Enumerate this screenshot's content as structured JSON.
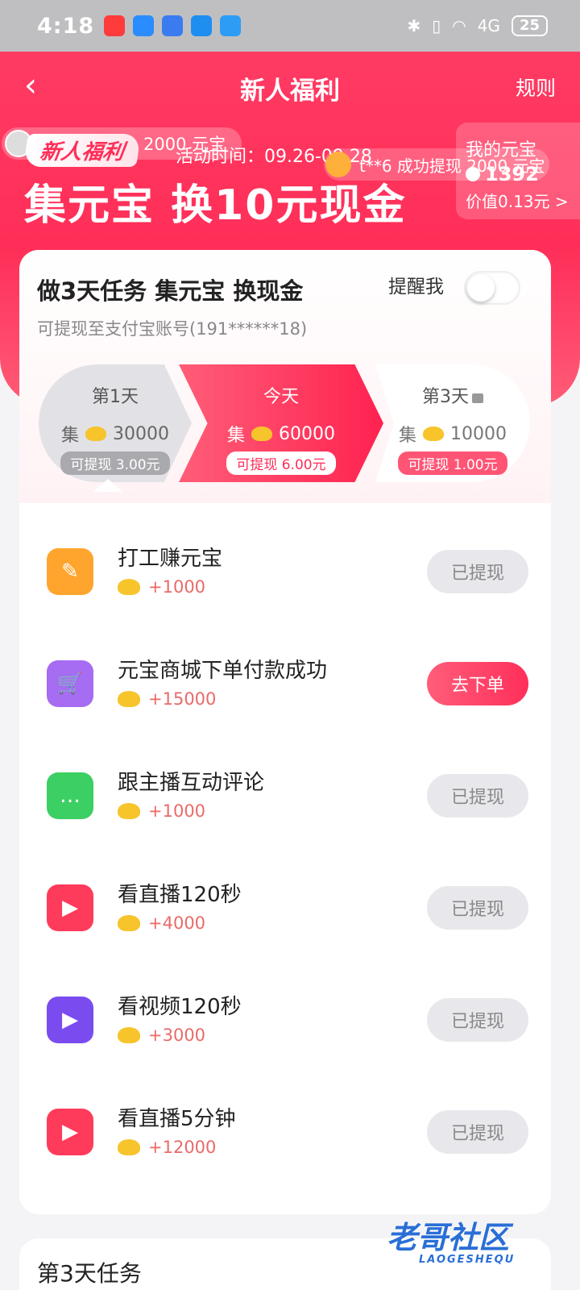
{
  "status": {
    "time": "4:18",
    "battery": "25",
    "network": "4G"
  },
  "nav": {
    "title": "新人福利",
    "rules_label": "规则"
  },
  "hero": {
    "ticker_left": "2000 元宝",
    "badge": "新人福利",
    "activity_time": "活动时间：09.26-09.28",
    "ticker_right": "t**6 成功提现 2000 元宝",
    "headline": "集元宝 换10元现金",
    "my_coins_label": "我的元宝",
    "my_coins_value": "1392",
    "my_coins_worth": "价值0.13元 >"
  },
  "card": {
    "title": "做3天任务 集元宝 换现金",
    "remind_label": "提醒我",
    "remind_on": false,
    "subtitle": "可提现至支付宝账号(191******18)",
    "days": [
      {
        "label": "第1天",
        "collect": "集",
        "amount": "30000",
        "withdraw": "可提现 3.00元"
      },
      {
        "label": "今天",
        "collect": "集",
        "amount": "60000",
        "withdraw": "可提现 6.00元"
      },
      {
        "label": "第3天",
        "collect": "集",
        "amount": "10000",
        "withdraw": "可提现 1.00元"
      }
    ]
  },
  "tasks": [
    {
      "name": "打工赚元宝",
      "reward": "+1000",
      "button": "已提现",
      "icon": "brush-icon",
      "icon_color": "#ffa52e"
    },
    {
      "name": "元宝商城下单付款成功",
      "reward": "+15000",
      "button": "去下单",
      "icon": "shopping-cart-icon",
      "icon_color": "#a66cf2"
    },
    {
      "name": "跟主播互动评论",
      "reward": "+1000",
      "button": "已提现",
      "icon": "chat-bubble-icon",
      "icon_color": "#3ccf63"
    },
    {
      "name": "看直播120秒",
      "reward": "+4000",
      "button": "已提现",
      "icon": "play-icon",
      "icon_color": "#ff3b5c"
    },
    {
      "name": "看视频120秒",
      "reward": "+3000",
      "button": "已提现",
      "icon": "play-icon",
      "icon_color": "#7a4cf0"
    },
    {
      "name": "看直播5分钟",
      "reward": "+12000",
      "button": "已提现",
      "icon": "play-icon",
      "icon_color": "#ff3b5c"
    }
  ],
  "day3_section": {
    "title": "第3天任务"
  },
  "watermark": {
    "main": "老哥社区",
    "sub": "LAOGESHEQU"
  },
  "colors": {
    "accent": "#ff2e58",
    "done_button": "#e8e8ec",
    "reward_text": "#e96a6a"
  }
}
